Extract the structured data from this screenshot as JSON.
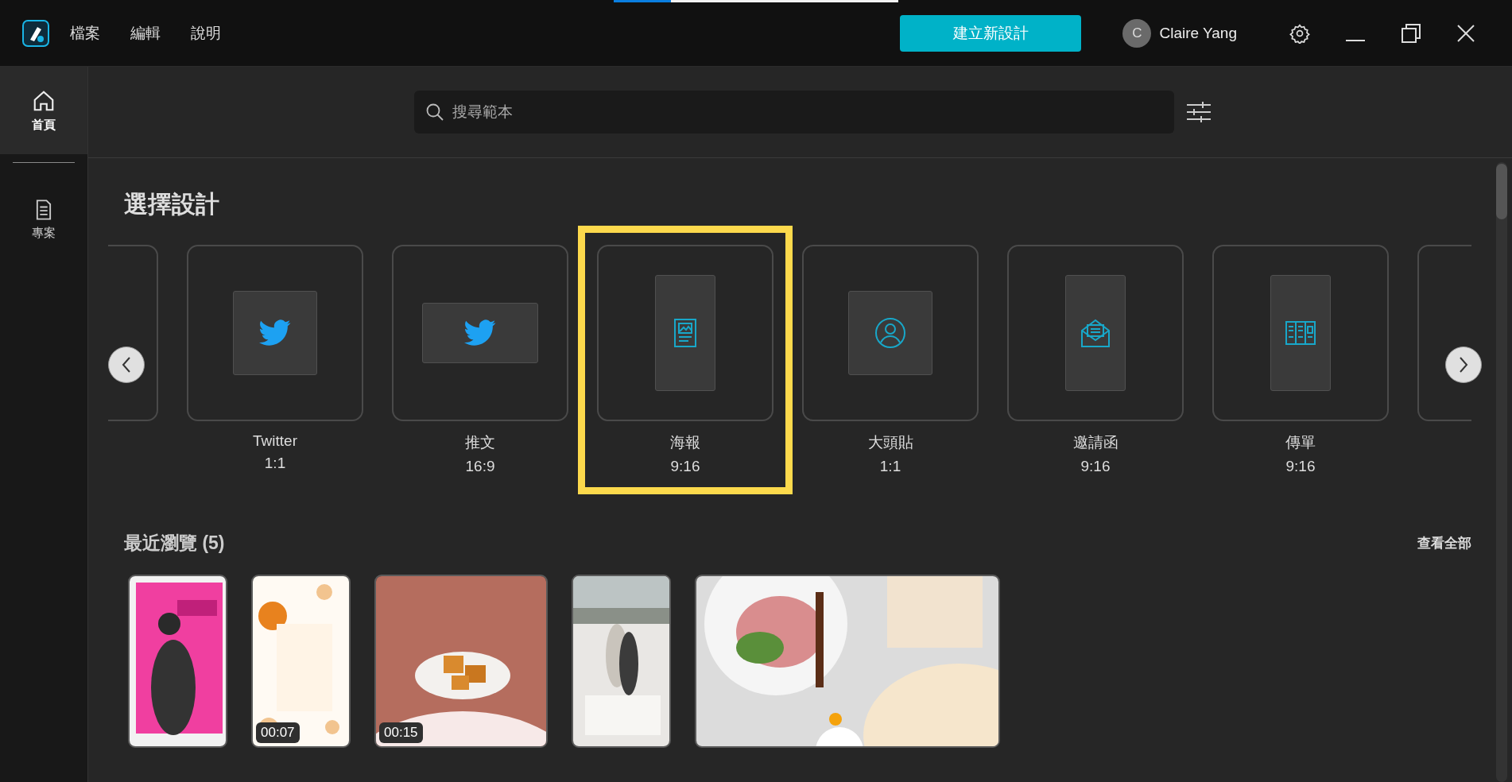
{
  "loading_bar": {
    "level": 0.2
  },
  "menu": [
    "檔案",
    "編輯",
    "說明"
  ],
  "create_button": "建立新設計",
  "user": {
    "initial": "C",
    "name": "Claire Yang"
  },
  "sidebar": {
    "items": [
      {
        "label": "首頁",
        "kind": "home",
        "selected": true
      },
      {
        "label": "專案",
        "kind": "projects",
        "selected": false
      }
    ]
  },
  "search": {
    "placeholder": "搜尋範本"
  },
  "design_section": {
    "title": "選擇設計",
    "options": [
      {
        "label": "Twitter",
        "ratio": "1:1",
        "kind": "twitter",
        "selected": false
      },
      {
        "label": "推文",
        "ratio": "16:9",
        "kind": "tweet",
        "selected": false
      },
      {
        "label": "海報",
        "ratio": "9:16",
        "kind": "poster",
        "selected": true
      },
      {
        "label": "大頭貼",
        "ratio": "1:1",
        "kind": "avatar",
        "selected": false
      },
      {
        "label": "邀請函",
        "ratio": "9:16",
        "kind": "invitation",
        "selected": false
      },
      {
        "label": "傳單",
        "ratio": "9:16",
        "kind": "flyer",
        "selected": false
      }
    ]
  },
  "recent": {
    "title": "最近瀏覽 (5)",
    "view_all": "查看全部",
    "items": [
      {
        "kind": "picture"
      },
      {
        "kind": "picture",
        "duration": "00:07"
      },
      {
        "kind": "picture",
        "duration": "00:15"
      },
      {
        "kind": "picture"
      },
      {
        "kind": "picture"
      }
    ]
  }
}
